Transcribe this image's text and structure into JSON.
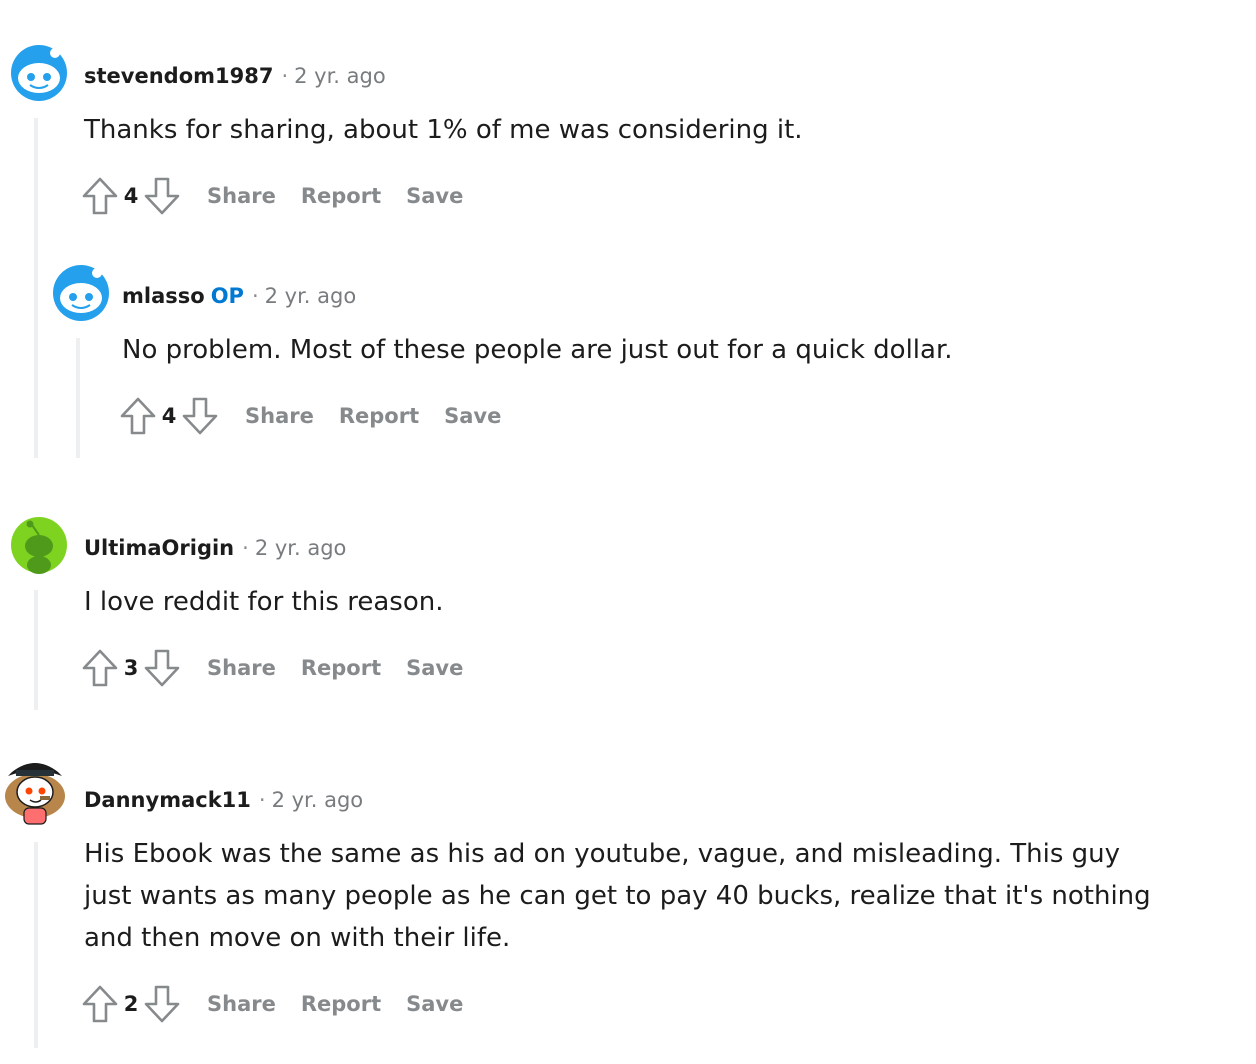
{
  "action_labels": {
    "share": "Share",
    "report": "Report",
    "save": "Save"
  },
  "comments": [
    {
      "author": "stevendom1987",
      "op_badge": "",
      "separator": "·",
      "time": "2 yr. ago",
      "body": "Thanks for sharing, about 1% of me was considering it.",
      "score": "4"
    },
    {
      "author": "mlasso",
      "op_badge": "OP",
      "separator": "·",
      "time": "2 yr. ago",
      "body": "No problem. Most of these people are just out for a quick dollar.",
      "score": "4"
    },
    {
      "author": "UltimaOrigin",
      "op_badge": "",
      "separator": "·",
      "time": "2 yr. ago",
      "body": "I love reddit for this reason.",
      "score": "3"
    },
    {
      "author": "Dannymack11",
      "op_badge": "",
      "separator": "·",
      "time": "2 yr. ago",
      "body": "His Ebook was the same as his ad on youtube, vague, and misleading. This guy just wants as many people as he can get to pay 40 bucks, realize that it's nothing and then move on with their life.",
      "score": "2"
    }
  ],
  "colors": {
    "op": "#0079d3",
    "thread_line": "#edeff1",
    "meta": "#787c7e",
    "action": "#878a8c"
  },
  "icons": {
    "upvote": "upvote-arrow-icon",
    "downvote": "downvote-arrow-icon"
  }
}
